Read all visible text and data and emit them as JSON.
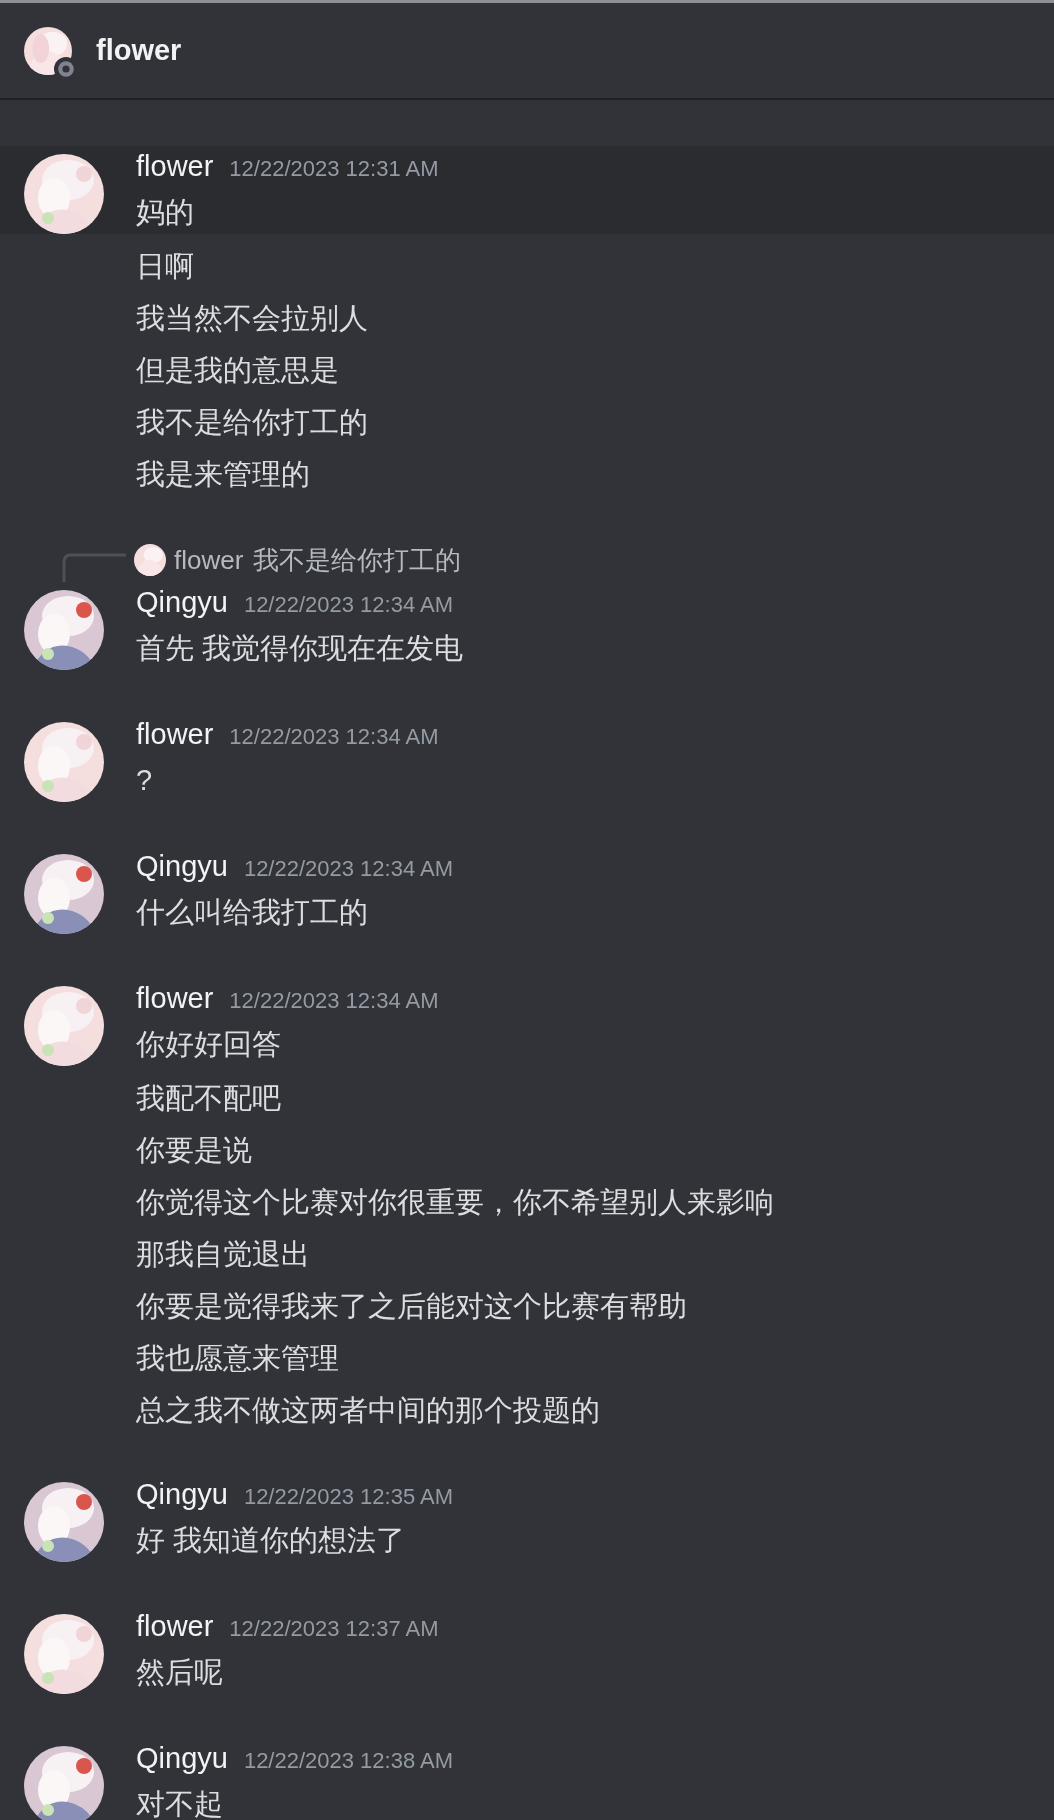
{
  "header": {
    "title": "flower",
    "online": false
  },
  "messages": [
    {
      "author": "flower",
      "timestamp": "12/22/2023 12:31 AM",
      "highlighted": true,
      "lines": [
        "妈的",
        "日啊",
        "我当然不会拉别人",
        "但是我的意思是",
        "我不是给你打工的",
        "我是来管理的"
      ]
    },
    {
      "author": "Qingyu",
      "timestamp": "12/22/2023 12:34 AM",
      "highlighted": false,
      "reply": {
        "author": "flower",
        "text": "我不是给你打工的"
      },
      "lines": [
        "首先 我觉得你现在在发电"
      ]
    },
    {
      "author": "flower",
      "timestamp": "12/22/2023 12:34 AM",
      "highlighted": false,
      "lines": [
        "?"
      ]
    },
    {
      "author": "Qingyu",
      "timestamp": "12/22/2023 12:34 AM",
      "highlighted": false,
      "lines": [
        "什么叫给我打工的"
      ]
    },
    {
      "author": "flower",
      "timestamp": "12/22/2023 12:34 AM",
      "highlighted": false,
      "lines": [
        "你好好回答",
        "我配不配吧",
        "你要是说",
        "你觉得这个比赛对你很重要，你不希望别人来影响",
        "那我自觉退出",
        "你要是觉得我来了之后能对这个比赛有帮助",
        "我也愿意来管理",
        "总之我不做这两者中间的那个投题的"
      ]
    },
    {
      "author": "Qingyu",
      "timestamp": "12/22/2023 12:35 AM",
      "highlighted": false,
      "lines": [
        "好 我知道你的想法了"
      ]
    },
    {
      "author": "flower",
      "timestamp": "12/22/2023 12:37 AM",
      "highlighted": false,
      "lines": [
        "然后呢"
      ]
    },
    {
      "author": "Qingyu",
      "timestamp": "12/22/2023 12:38 AM",
      "highlighted": false,
      "lines": [
        "对不起"
      ]
    }
  ]
}
